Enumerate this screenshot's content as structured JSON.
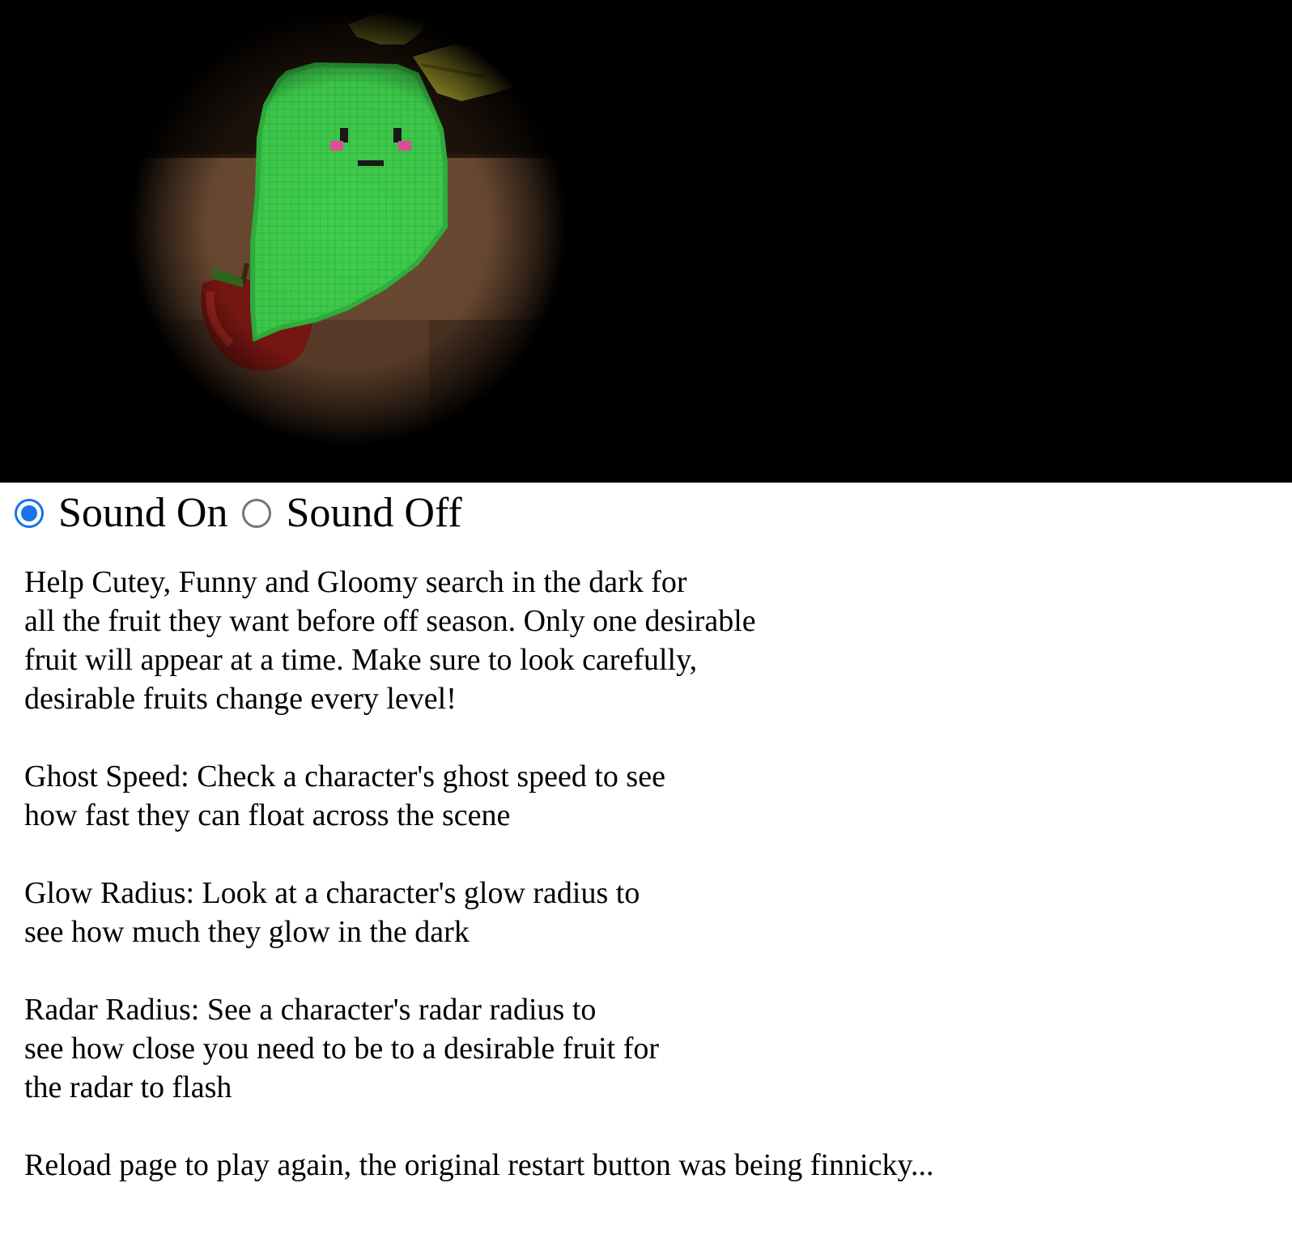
{
  "sound": {
    "on_label": "Sound On",
    "off_label": "Sound Off",
    "selected": "on"
  },
  "instructions": {
    "intro": [
      "Help Cutey, Funny and Gloomy search in the dark for",
      "all the fruit they want before off season. Only one desirable",
      "fruit will appear at a time. Make sure to look carefully,",
      "desirable fruits change every level!"
    ],
    "ghost_speed": [
      "Ghost Speed: Check a character's ghost speed to see",
      "how fast they can float across the scene"
    ],
    "glow_radius": [
      "Glow Radius: Look at a character's glow radius to",
      "see how much they glow in the dark"
    ],
    "radar_radius": [
      "Radar Radius: See a character's radar radius to",
      "see how close you need to be to a desirable fruit for",
      "the radar to flash"
    ],
    "reload_note": "Reload page to play again, the original restart button was being finnicky..."
  },
  "colors": {
    "canvas_bg": "#000000",
    "ghost_body": "#3fcf4e",
    "ghost_outline": "#2fb23d",
    "floor": "#6b4a32",
    "leaf": "#a8a02c",
    "apple": "#8a1a14",
    "blush": "#e2509a",
    "radio_accent": "#1a73e8"
  },
  "icons": {
    "ghost": "green-ghost-character",
    "fruit": "apple-icon",
    "leaf": "leaf-icon"
  }
}
